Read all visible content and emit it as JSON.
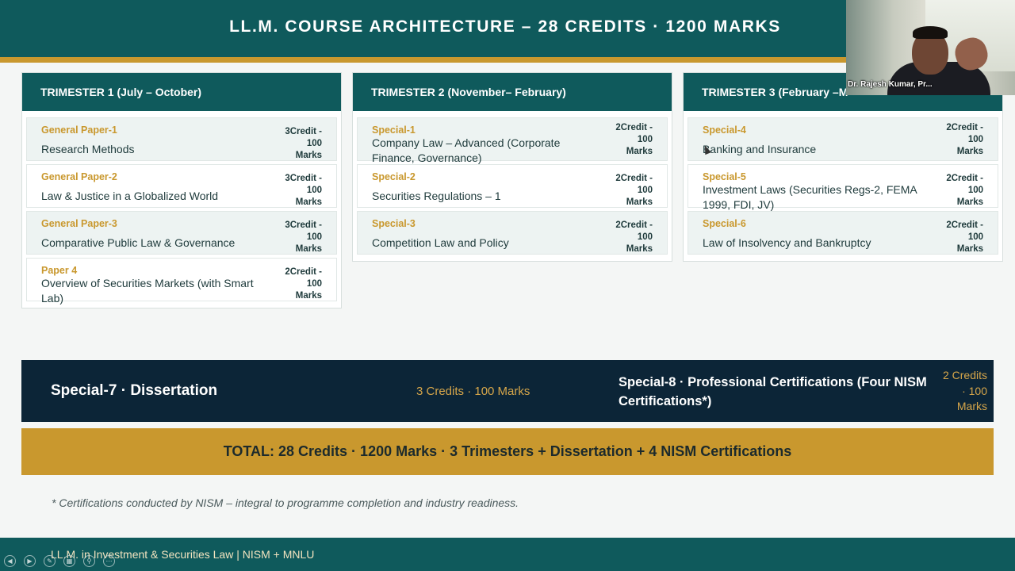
{
  "header": {
    "title": "LL.M. COURSE ARCHITECTURE  –  28 CREDITS  ·  1200 MARKS"
  },
  "trimesters": [
    {
      "title": "TRIMESTER 1  (July – October)",
      "courses": [
        {
          "code": "General Paper-1",
          "name": "Research Methods",
          "credit_lines": [
            "3Credit -",
            "100",
            "Marks"
          ]
        },
        {
          "code": "General Paper-2",
          "name": "Law & Justice in a Globalized World",
          "credit_lines": [
            "3Credit -",
            "100",
            "Marks"
          ]
        },
        {
          "code": "General Paper-3",
          "name": "Comparative Public Law & Governance",
          "credit_lines": [
            "3Credit -",
            "100",
            "Marks"
          ]
        },
        {
          "code": "Paper 4",
          "name": "Overview of Securities Markets (with Smart Lab)",
          "credit_lines": [
            "2Credit -",
            "100",
            "Marks"
          ]
        }
      ]
    },
    {
      "title": "TRIMESTER 2  (November– February)",
      "courses": [
        {
          "code": "Special-1",
          "name": "Company Law – Advanced (Corporate Finance, Governance)",
          "credit_lines": [
            "2Credit -",
            "100",
            "Marks"
          ]
        },
        {
          "code": "Special-2",
          "name": "Securities Regulations – 1",
          "credit_lines": [
            "2Credit -",
            "100",
            "Marks"
          ]
        },
        {
          "code": "Special-3",
          "name": "Competition Law and Policy",
          "credit_lines": [
            "2Credit -",
            "100",
            "Marks"
          ]
        }
      ]
    },
    {
      "title": "TRIMESTER 3  (February –M",
      "courses": [
        {
          "code": "Special-4",
          "name": "Banking and Insurance",
          "credit_lines": [
            "2Credit -",
            "100",
            "Marks"
          ]
        },
        {
          "code": "Special-5",
          "name": "Investment Laws (Securities Regs-2, FEMA 1999, FDI, JV)",
          "credit_lines": [
            "2Credit -",
            "100",
            "Marks"
          ]
        },
        {
          "code": "Special-6",
          "name": "Law of Insolvency and Bankruptcy",
          "credit_lines": [
            "2Credit -",
            "100",
            "Marks"
          ]
        }
      ]
    }
  ],
  "banner": {
    "special7_label": "Special-7  ·  Dissertation",
    "special7_credits": "3 Credits  ·  100 Marks",
    "special8_label": "Special-8  ·  Professional Certifications (Four NISM Certifications*)",
    "special8_credit_lines": [
      "2 Credits",
      "·  100",
      "Marks"
    ]
  },
  "total": {
    "text": "TOTAL:  28 Credits  ·  1200 Marks  ·  3 Trimesters  +  Dissertation  +  4 NISM Certifications"
  },
  "note": {
    "text": "* Certifications conducted by NISM – integral to programme completion and industry readiness."
  },
  "footer": {
    "text": "LL.M. in Investment & Securities Law  |  NISM + MNLU"
  },
  "video": {
    "participant_name": "Dr. Rajesh Kumar, Pr..."
  },
  "colors": {
    "teal": "#0f5a5c",
    "gold": "#c9982e",
    "navy": "#0c2537"
  }
}
